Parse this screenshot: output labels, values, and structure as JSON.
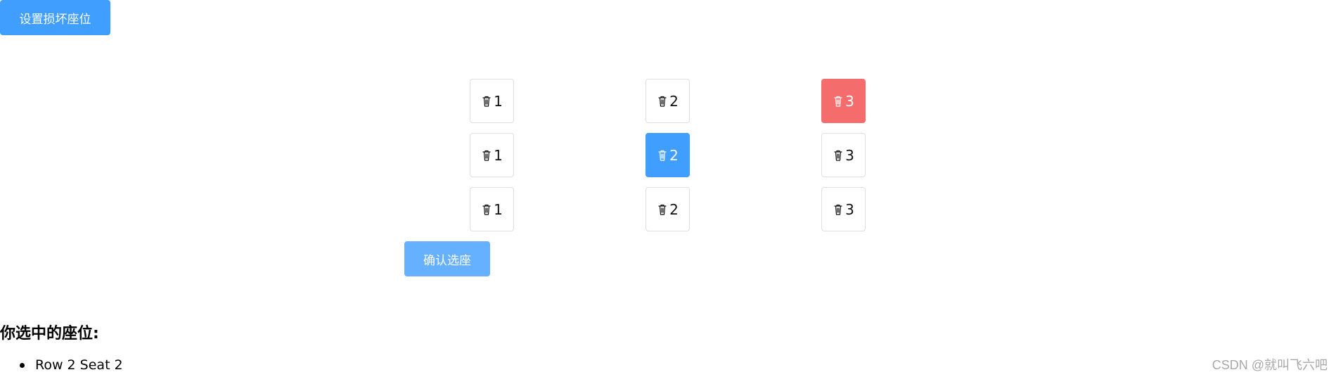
{
  "toolbar": {
    "set_broken_label": "设置损坏座位"
  },
  "seats": [
    {
      "row": 1,
      "number": "1",
      "state": "normal",
      "icon": "trash-icon"
    },
    {
      "row": 1,
      "number": "2",
      "state": "normal",
      "icon": "trash-icon"
    },
    {
      "row": 1,
      "number": "3",
      "state": "broken",
      "icon": "trash-icon"
    },
    {
      "row": 2,
      "number": "1",
      "state": "normal",
      "icon": "trash-icon"
    },
    {
      "row": 2,
      "number": "2",
      "state": "selected",
      "icon": "trash-icon"
    },
    {
      "row": 2,
      "number": "3",
      "state": "normal",
      "icon": "trash-icon"
    },
    {
      "row": 3,
      "number": "1",
      "state": "normal",
      "icon": "trash-icon"
    },
    {
      "row": 3,
      "number": "2",
      "state": "normal",
      "icon": "trash-icon"
    },
    {
      "row": 3,
      "number": "3",
      "state": "normal",
      "icon": "trash-icon"
    }
  ],
  "actions": {
    "confirm_label": "确认选座"
  },
  "selection": {
    "title": "你选中的座位:",
    "items": [
      "Row 2 Seat 2"
    ]
  },
  "watermark": {
    "text": "CSDN @就叫飞六吧"
  },
  "colors": {
    "primary": "#409eff",
    "primary_light": "#66b1ff",
    "danger": "#f56c6c",
    "border": "#dcdfe6"
  }
}
